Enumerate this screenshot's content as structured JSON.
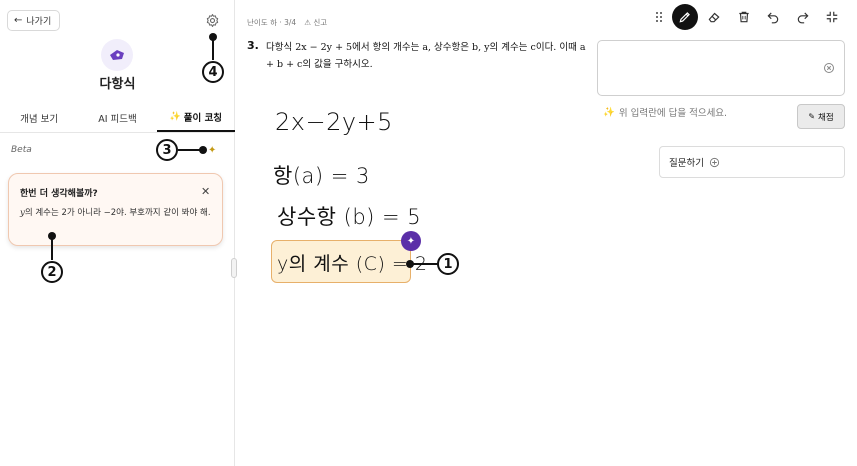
{
  "nav": {
    "back_label": "나가기"
  },
  "subject": {
    "title": "다항식"
  },
  "tabs": [
    {
      "label": "개념 보기"
    },
    {
      "label": "AI 피드백"
    },
    {
      "label": "풀이 코칭"
    }
  ],
  "beta_label": "Beta",
  "hint": {
    "title": "한번 더 생각해볼까?",
    "body_var": "y",
    "body_text": "의 계수는 2가 아니라 −2야. 부호까지 같이 봐야 해."
  },
  "question": {
    "meta_level": "난이도 하 · 3/4",
    "meta_report": "신고",
    "number": "3.",
    "text": "다항식 2x − 2y + 5에서 항의 개수는 a, 상수항은 b, y의 계수는 c이다. 이때 a + b + c의 값을 구하시오."
  },
  "answer": {
    "placeholder_hint": "위 입력란에 답을 적으세요.",
    "grade_label": "채점",
    "ask_label": "질문하기"
  },
  "handwriting": [
    "2x−2y+5",
    "항(a) = 3",
    "상수항 (b) = 5",
    "y의 계수 (C) = 2"
  ],
  "annotations": [
    "1",
    "2",
    "3",
    "4"
  ],
  "colors": {
    "accent_purple": "#5b2fa8",
    "highlight_fill": "#fdf0d6",
    "highlight_border": "#e7b06a",
    "hint_border": "#f0c8b0"
  },
  "icons": {
    "toolbar": [
      "drag-handle-icon",
      "pen-icon",
      "eraser-icon",
      "trash-icon",
      "undo-icon",
      "redo-icon",
      "collapse-icon"
    ]
  }
}
